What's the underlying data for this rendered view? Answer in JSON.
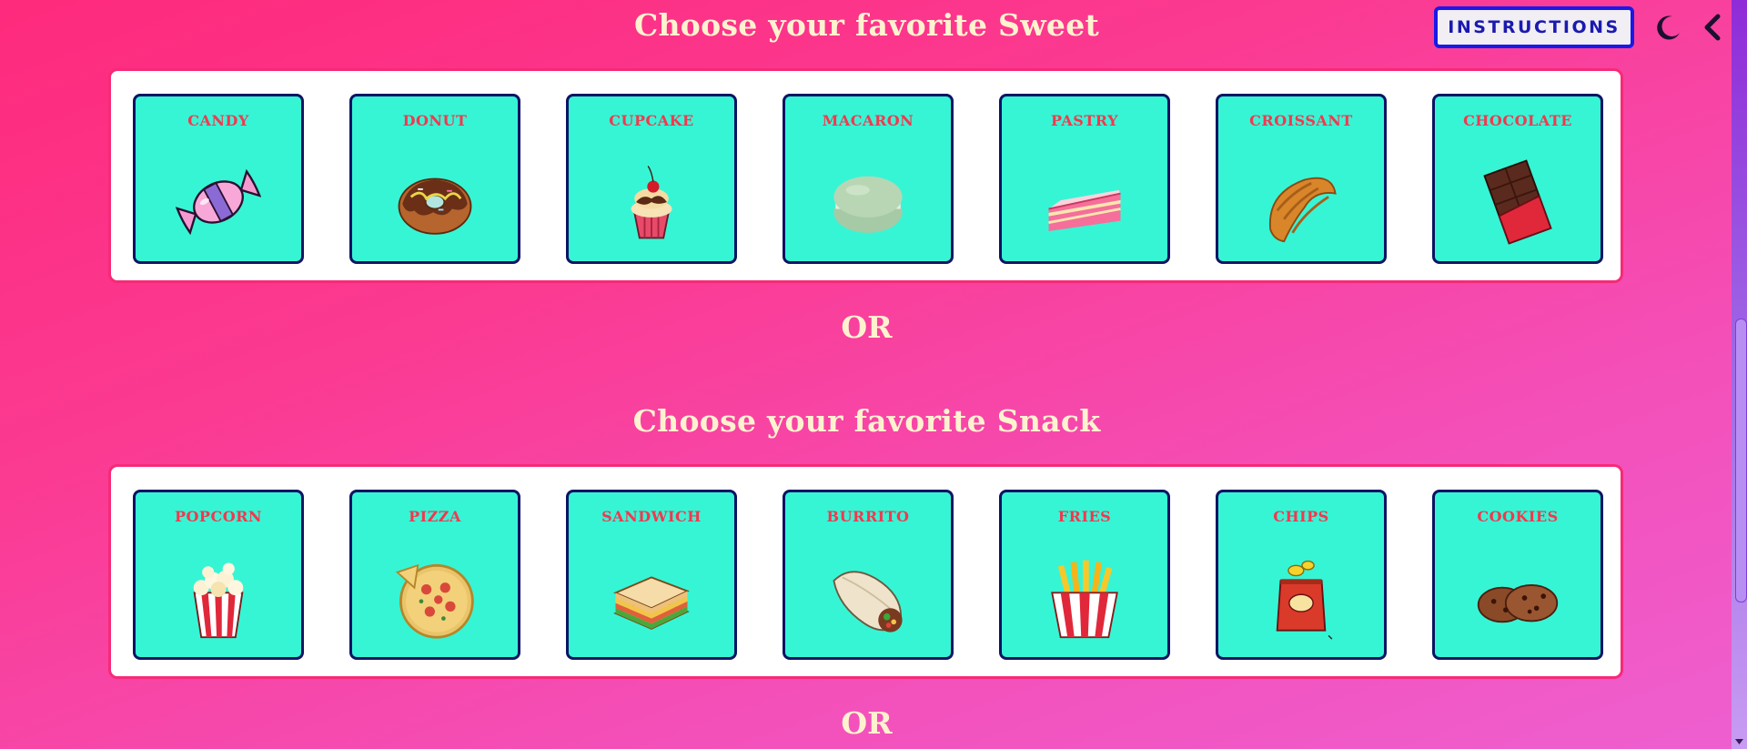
{
  "header": {
    "instructions_label": "INSTRUCTIONS"
  },
  "sections": [
    {
      "title": "Choose your favorite Sweet",
      "items": [
        {
          "label": "CANDY",
          "icon": "candy-icon"
        },
        {
          "label": "DONUT",
          "icon": "donut-icon"
        },
        {
          "label": "CUPCAKE",
          "icon": "cupcake-icon"
        },
        {
          "label": "MACARON",
          "icon": "macaron-icon"
        },
        {
          "label": "PASTRY",
          "icon": "pastry-icon"
        },
        {
          "label": "CROISSANT",
          "icon": "croissant-icon"
        },
        {
          "label": "CHOCOLATE",
          "icon": "chocolate-icon"
        }
      ]
    },
    {
      "title": "Choose your favorite Snack",
      "items": [
        {
          "label": "POPCORN",
          "icon": "popcorn-icon"
        },
        {
          "label": "PIZZA",
          "icon": "pizza-icon"
        },
        {
          "label": "SANDWICH",
          "icon": "sandwich-icon"
        },
        {
          "label": "BURRITO",
          "icon": "burrito-icon"
        },
        {
          "label": "FRIES",
          "icon": "fries-icon"
        },
        {
          "label": "CHIPS",
          "icon": "chips-icon"
        },
        {
          "label": "COOKIES",
          "icon": "cookies-icon"
        }
      ]
    }
  ],
  "separators": [
    "OR",
    "OR"
  ],
  "colors": {
    "background_top": "#fe2a7c",
    "background_bottom": "#ee5fd0",
    "card_fill": "#36f5d5",
    "card_border": "#0c1463",
    "label_red": "#f2384f",
    "title_cream": "#fff3cf",
    "button_border": "#1a1ae6"
  }
}
